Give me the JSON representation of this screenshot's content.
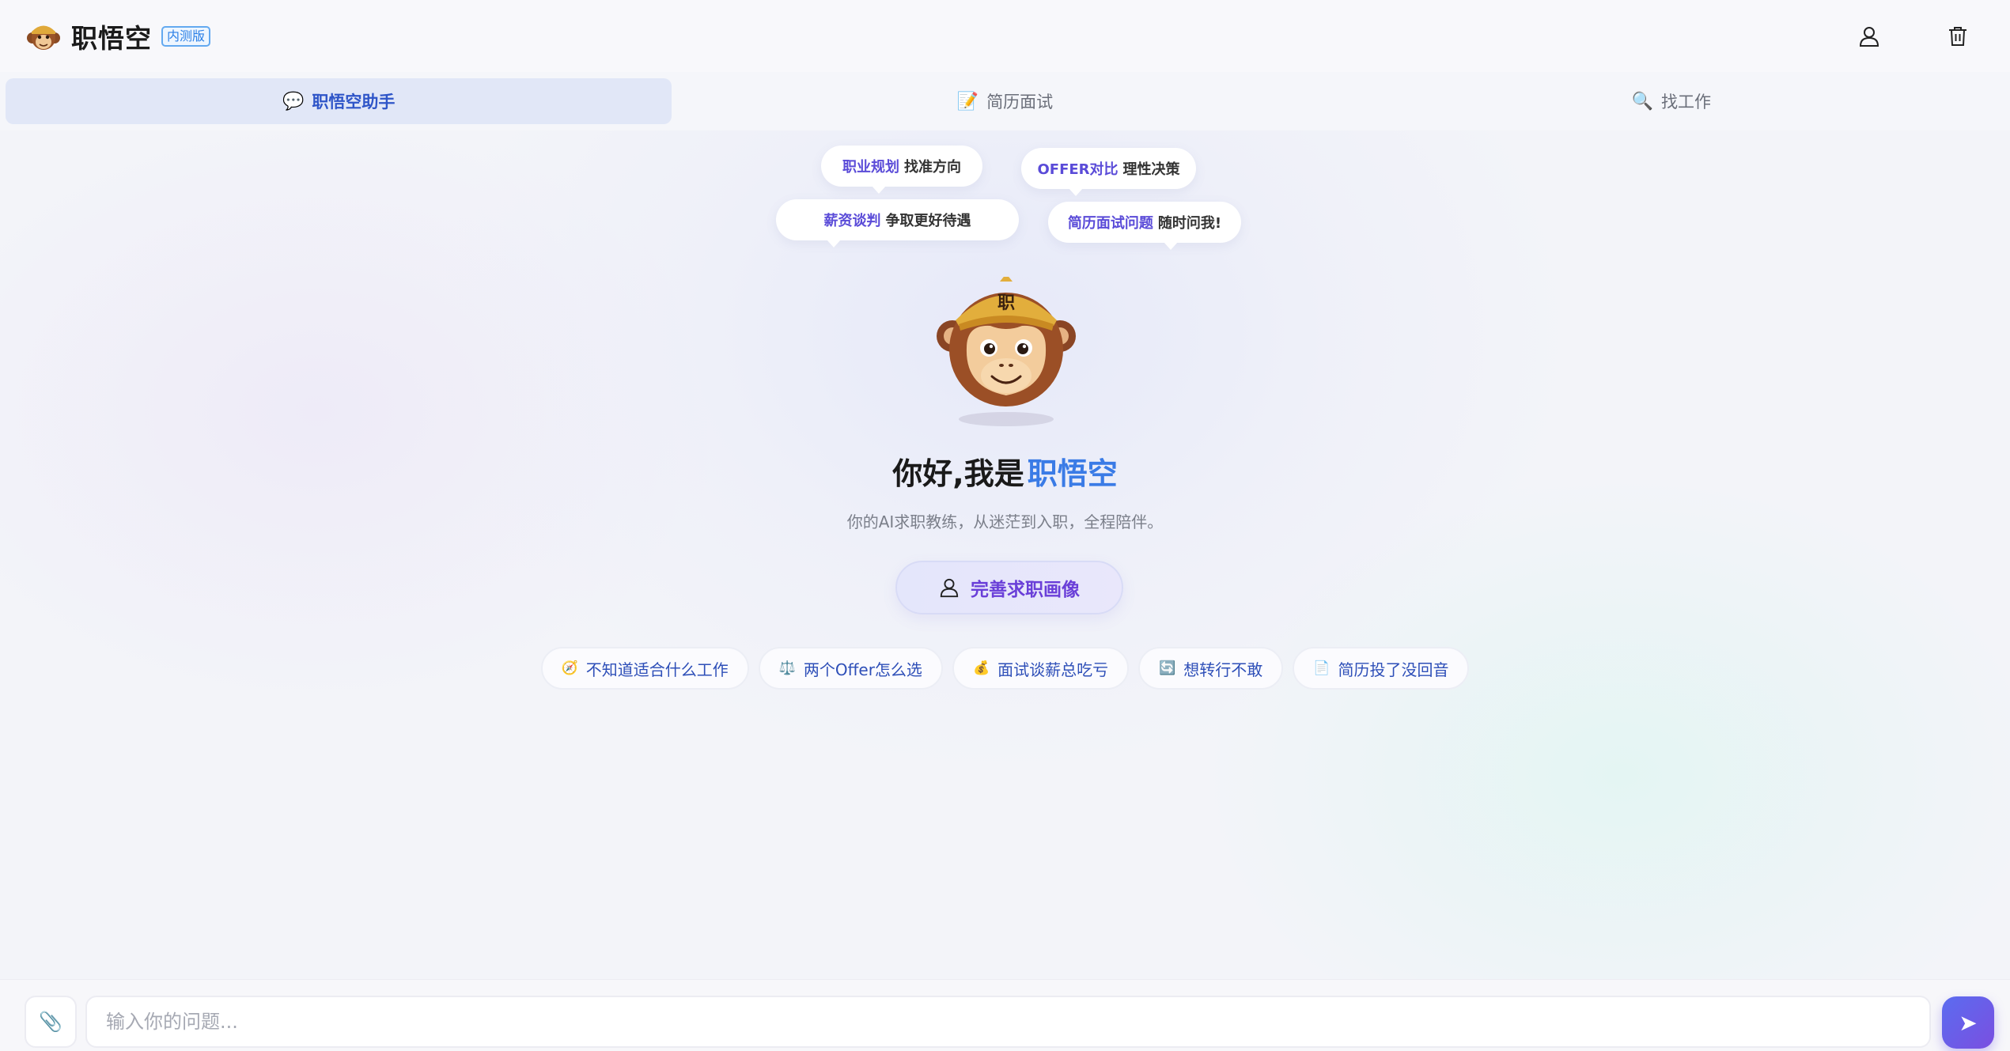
{
  "header": {
    "app_title": "职悟空",
    "beta_badge": "内测版",
    "actions": [
      {
        "icon": "user-icon"
      },
      {
        "icon": "trash-icon"
      }
    ]
  },
  "tabs": [
    {
      "label": "职悟空助手",
      "emoji": "💬",
      "active": true
    },
    {
      "label": "简历面试",
      "emoji": "📝",
      "active": false
    },
    {
      "label": "找工作",
      "emoji": "🔍",
      "active": false
    }
  ],
  "bubbles": [
    {
      "highlight": "职业规划",
      "text": "找准方向"
    },
    {
      "highlight": "OFFER对比",
      "text": "理性决策"
    },
    {
      "highlight": "薪资谈判",
      "text": "争取更好待遇"
    },
    {
      "highlight": "简历面试问题",
      "text": "随时问我!"
    }
  ],
  "mascot": {
    "hat_text": "职"
  },
  "greeting": {
    "prefix": "你好,我是",
    "brand": "职悟空"
  },
  "subtitle": "你的AI求职教练，从迷茫到入职，全程陪伴。",
  "profile_button": {
    "label": "完善求职画像"
  },
  "suggestions": [
    {
      "emoji": "🧭",
      "label": "不知道适合什么工作"
    },
    {
      "emoji": "⚖️",
      "label": "两个Offer怎么选"
    },
    {
      "emoji": "💰",
      "label": "面试谈薪总吃亏"
    },
    {
      "emoji": "🔄",
      "label": "想转行不敢"
    },
    {
      "emoji": "📄",
      "label": "简历投了没回音"
    }
  ],
  "input": {
    "placeholder": "输入你的问题...",
    "value": "",
    "attach_icon": "📎",
    "send_icon": "➤"
  },
  "colors": {
    "accent": "#3a7be6",
    "brand_purple": "#6a3fd8",
    "active_tab_bg": "#e1e7f7"
  }
}
